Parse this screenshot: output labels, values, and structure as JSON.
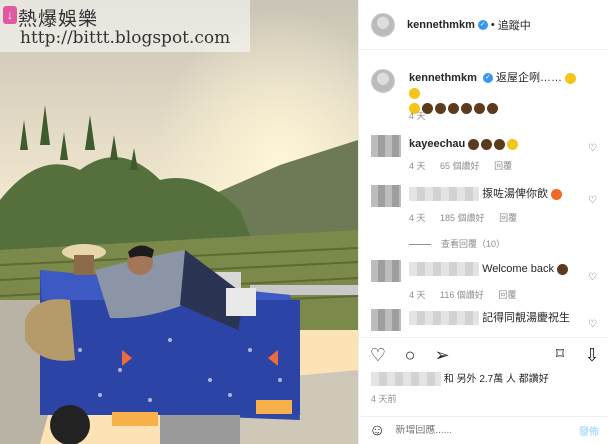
{
  "watermark": {
    "title": "熱爆娛樂",
    "url": "http://bittt.blogspot.com"
  },
  "header": {
    "username": "kennethmkm",
    "follow_label": "追蹤中",
    "separator": "•"
  },
  "caption": {
    "username": "kennethmkm",
    "text": "返屋企咧……",
    "time": "4 天"
  },
  "comments": [
    {
      "username": "kayeechau",
      "text": "",
      "time": "4 天",
      "likes": "65 個讚好",
      "reply": "回覆"
    },
    {
      "username": "",
      "text": "揼咗湯俾你飲",
      "time": "4 天",
      "likes": "185 個讚好",
      "reply": "回覆",
      "view_replies": "查看回覆（10）"
    },
    {
      "username": "",
      "text": "Welcome back",
      "time": "4 天",
      "likes": "116 個讚好",
      "reply": "回覆"
    },
    {
      "username": "",
      "text": "記得同靚湯慶祝生"
    }
  ],
  "likes_summary": {
    "prefix": "和",
    "text": "另外 2.7萬 人 都讚好"
  },
  "post_time": "4 天前",
  "add_comment": {
    "placeholder": "新增回應......",
    "post_label": "發佈"
  },
  "icons": {
    "heart": "heart-icon",
    "comment": "comment-icon",
    "share": "share-icon",
    "save": "bookmark-icon",
    "emoji": "smile-icon"
  }
}
